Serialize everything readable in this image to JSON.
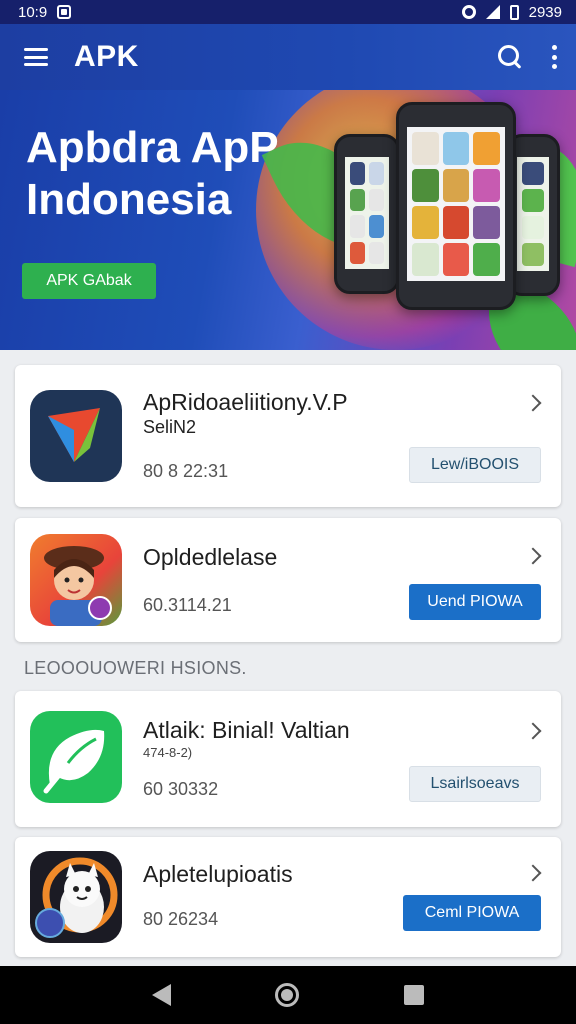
{
  "status_bar": {
    "time": "10:9",
    "right_text": "2939",
    "icons": [
      "notification-icon",
      "ring-icon",
      "signal-icon",
      "battery-icon"
    ]
  },
  "app_bar": {
    "title": "APK",
    "icons": [
      "menu-icon",
      "search-icon",
      "more-vert-icon"
    ]
  },
  "banner": {
    "title_line1": "Apbdra ApP",
    "title_line2": "Indonesia",
    "button_label": "APK GAbak",
    "carousel_dots": 4
  },
  "apps_top": [
    {
      "name": "ApRidoaeliitiony.V.P",
      "subtitle": "SeliN2",
      "meta": "80 8 22:31",
      "button_label": "Lew/iBOOIS",
      "button_style": "light",
      "icon": "arrow-logo-icon"
    },
    {
      "name": "Opldedlelase",
      "subtitle": "",
      "meta": "60.3114.21",
      "button_label": "Uend PIOWA",
      "button_style": "blue",
      "icon": "character-avatar-icon"
    }
  ],
  "section_label": "LEOOOUOWERI HSIONS.",
  "apps_bottom": [
    {
      "name": "Atlaik: Binial! Valtian",
      "subtitle": "474-8-2)",
      "meta": "60 30332",
      "button_label": "Lsairlsoeavs",
      "button_style": "light",
      "icon": "leaf-chat-icon"
    },
    {
      "name": "Apletelupioatis",
      "subtitle": "",
      "meta": "80 26234",
      "button_label": "Ceml PIOWA",
      "button_style": "blue",
      "icon": "cartoon-cat-icon"
    }
  ],
  "nav_bar": {
    "icons": [
      "back-icon",
      "home-icon",
      "recents-icon"
    ]
  },
  "colors": {
    "app_bar": "#1f49b2",
    "green_button": "#2eb04f",
    "blue_button": "#1b6fc8",
    "light_button": "#e9eef3",
    "background": "#eceef1"
  }
}
